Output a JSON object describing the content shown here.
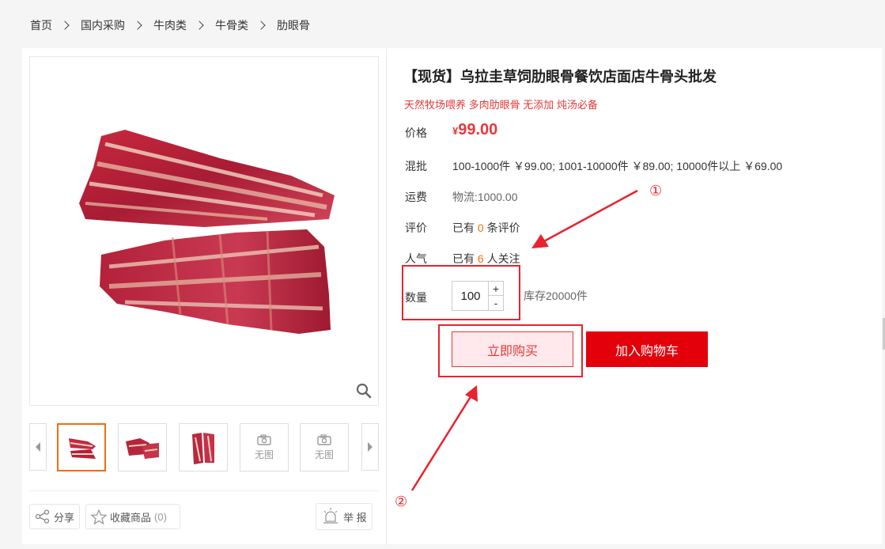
{
  "breadcrumb": [
    "首页",
    "国内采购",
    "牛肉类",
    "牛骨类",
    "肋眼骨"
  ],
  "product": {
    "title": "【现货】乌拉圭草饲肋眼骨餐饮店面店牛骨头批发",
    "subtitle": "天然牧场喂养 多肉肋眼骨 无添加 炖汤必备"
  },
  "price": {
    "label": "价格",
    "currency": "¥",
    "value": "99.00"
  },
  "wholesale": {
    "label": "混批",
    "text": "100-1000件 ￥99.00; 1001-10000件 ￥89.00; 10000件以上 ￥69.00"
  },
  "shipping": {
    "label": "运费",
    "text": "物流:1000.00"
  },
  "reviews": {
    "label": "评价",
    "prefix": "已有",
    "count": "0",
    "suffix": "条评价"
  },
  "popularity": {
    "label": "人气",
    "prefix": "已有",
    "count": "6",
    "suffix": "人关注"
  },
  "quantity": {
    "label": "数量",
    "value": "100",
    "plus": "+",
    "minus": "-",
    "stock": "库存20000件"
  },
  "buttons": {
    "buy_now": "立即购买",
    "add_to_cart": "加入购物车"
  },
  "thumbnails": {
    "no_image": "无图"
  },
  "actions": {
    "share": "分享",
    "favorite": "收藏商品",
    "favorite_count": "(0)",
    "report": "举 报"
  },
  "annotations": [
    "①",
    "②"
  ],
  "colors": {
    "accent_red": "#e4393c",
    "cart_red": "#e4000b",
    "highlight_orange": "#f06d13",
    "annotation_red": "#e8232e"
  }
}
